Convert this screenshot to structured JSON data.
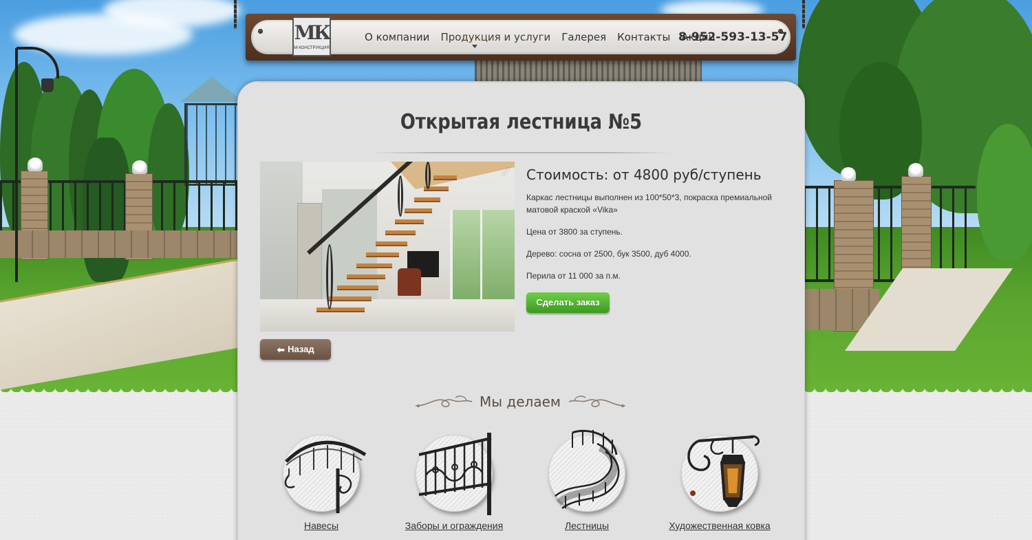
{
  "header": {
    "logo_text": "МК",
    "logo_subtext": "М-КОНСТРУКЦИЯ",
    "nav": [
      {
        "label": "О компании"
      },
      {
        "label": "Продукция и услуги"
      },
      {
        "label": "Галерея"
      },
      {
        "label": "Контакты"
      },
      {
        "label": "Акции"
      }
    ],
    "phone": "8-952-593-13-57"
  },
  "product": {
    "title": "Открытая лестница №5",
    "price": "Стоимость: от 4800 руб/ступень",
    "description": [
      "Каркас лестницы выполнен из 100*50*3, покраска премиальной матовой краской «Vika»",
      "Цена от 3800 за ступень.",
      "Дерево: сосна от 2500, бук 3500, дуб 4000.",
      "Перила от 11 000 за п.м."
    ],
    "order_button": "Сделать заказ",
    "back_button": "Назад"
  },
  "we_make": {
    "title": "Мы делаем",
    "services": [
      {
        "label": "Навесы",
        "icon": "canopy-icon"
      },
      {
        "label": "Заборы и ограждения",
        "icon": "fence-icon"
      },
      {
        "label": "Лестницы",
        "icon": "staircase-icon"
      },
      {
        "label": "Художественная ковка",
        "icon": "lantern-icon"
      }
    ]
  },
  "colors": {
    "order_button": "#4cb42a",
    "back_button": "#7a6152",
    "header_wood": "#5a3b27"
  }
}
